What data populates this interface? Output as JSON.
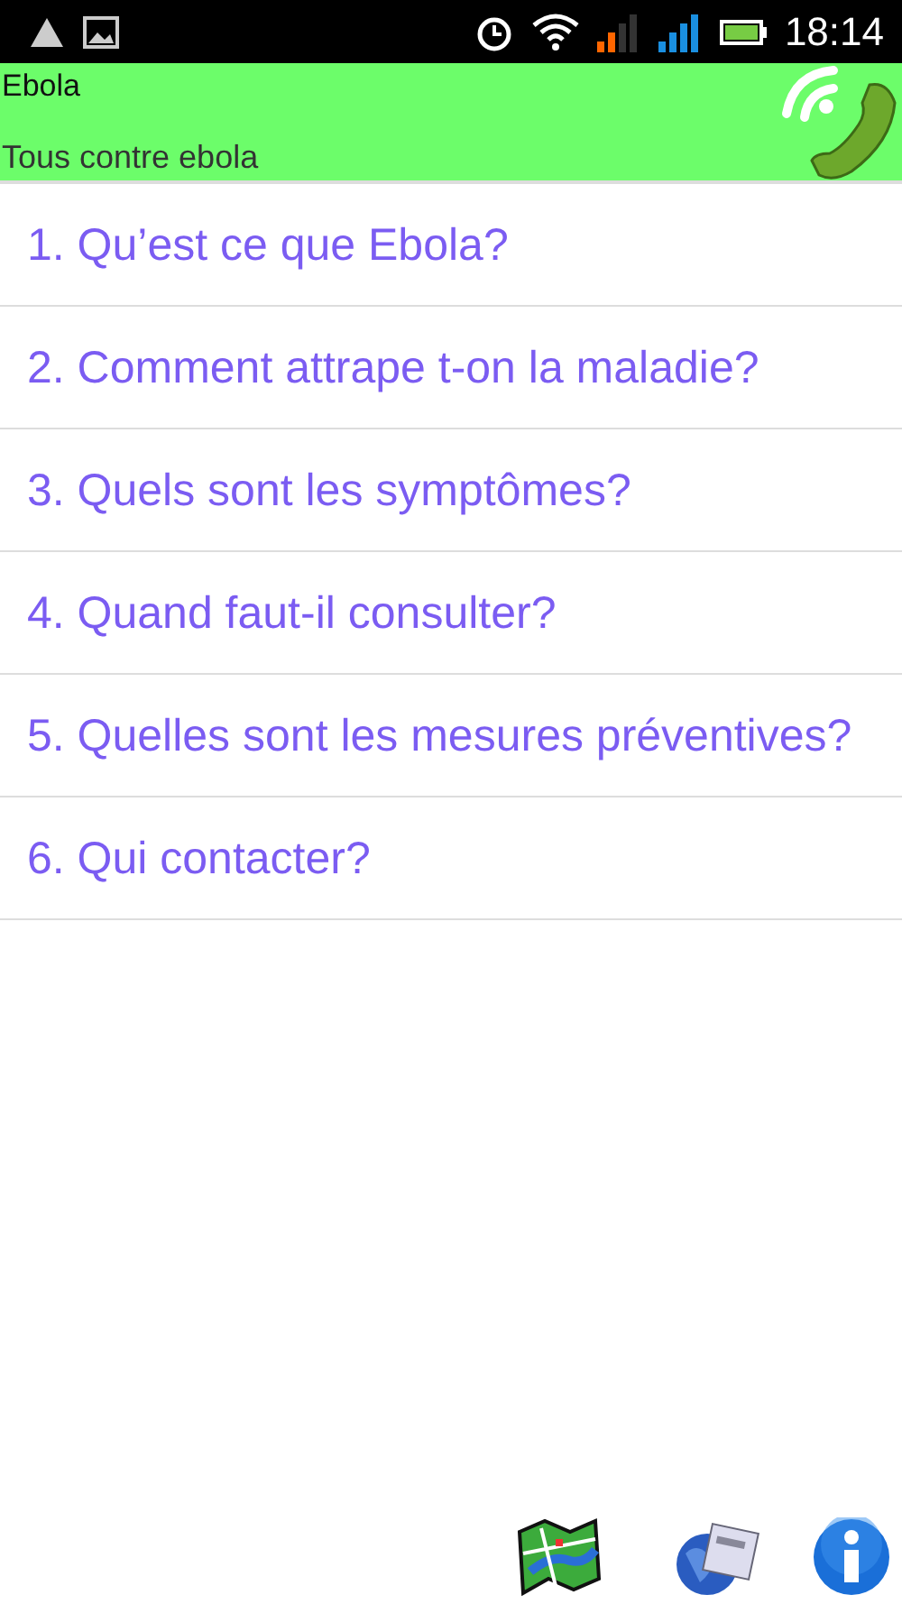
{
  "status_bar": {
    "time": "18:14"
  },
  "header": {
    "title": "Ebola",
    "subtitle": "Tous contre ebola"
  },
  "menu": [
    {
      "label": "1. Qu’est ce que Ebola?"
    },
    {
      "label": "2. Comment attrape t-on la maladie?"
    },
    {
      "label": "3. Quels sont les symptômes?"
    },
    {
      "label": "4. Quand faut-il consulter?"
    },
    {
      "label": "5. Quelles sont les mesures préventives?"
    },
    {
      "label": "6. Qui contacter?"
    }
  ],
  "bottom_bar": [
    {
      "kind": "map"
    },
    {
      "kind": "news"
    },
    {
      "kind": "info"
    }
  ]
}
